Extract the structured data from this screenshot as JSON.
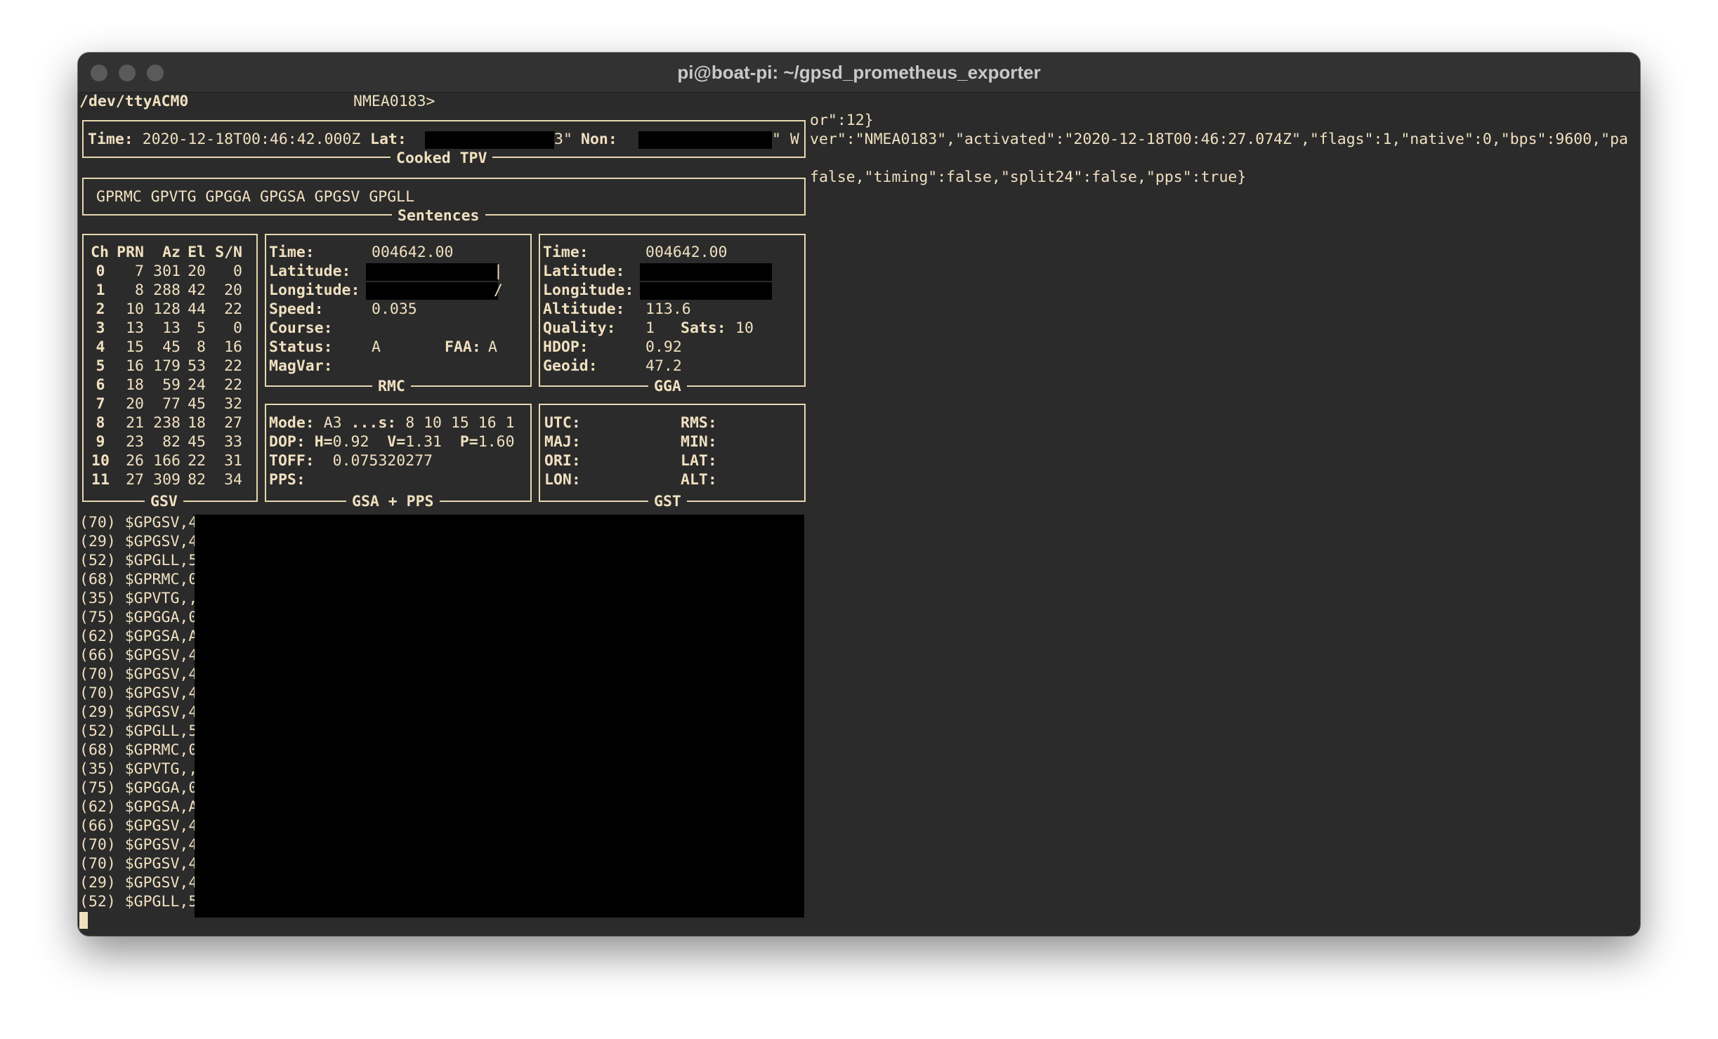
{
  "window": {
    "title": "pi@boat-pi: ~/gpsd_prometheus_exporter"
  },
  "header": {
    "device": "/dev/ttyACM0",
    "mode": "NMEA0183>"
  },
  "tpv": {
    "caption": "Cooked TPV",
    "time_label": "Time:",
    "time": "2020-12-18T00:46:42.000Z",
    "lat_label": "Lat:",
    "lat_tail": "3\"",
    "lon_label": "Non:",
    "lon_tail": "\" W"
  },
  "sentences": {
    "caption": "Sentences",
    "list": "GPRMC GPVTG GPGGA GPGSA GPGSV GPGLL"
  },
  "json_lines": [
    "or\":12}",
    "ver\":\"NMEA0183\",\"activated\":\"2020-12-18T00:46:27.074Z\",\"flags\":1,\"native\":0,\"bps\":9600,\"pa",
    "false,\"timing\":false,\"split24\":false,\"pps\":true}"
  ],
  "gsv": {
    "caption": "GSV",
    "headers": [
      "Ch",
      "PRN",
      "Az",
      "El",
      "S/N"
    ],
    "rows": [
      [
        "0",
        "7",
        "301",
        "20",
        "0"
      ],
      [
        "1",
        "8",
        "288",
        "42",
        "20"
      ],
      [
        "2",
        "10",
        "128",
        "44",
        "22"
      ],
      [
        "3",
        "13",
        "13",
        "5",
        "0"
      ],
      [
        "4",
        "15",
        "45",
        "8",
        "16"
      ],
      [
        "5",
        "16",
        "179",
        "53",
        "22"
      ],
      [
        "6",
        "18",
        "59",
        "24",
        "22"
      ],
      [
        "7",
        "20",
        "77",
        "45",
        "32"
      ],
      [
        "8",
        "21",
        "238",
        "18",
        "27"
      ],
      [
        "9",
        "23",
        "82",
        "45",
        "33"
      ],
      [
        "10",
        "26",
        "166",
        "22",
        "31"
      ],
      [
        "11",
        "27",
        "309",
        "82",
        "34"
      ]
    ]
  },
  "rmc": {
    "caption": "RMC",
    "time_label": "Time:",
    "time": "004642.00",
    "lat_label": "Latitude:",
    "lat_tail": "|",
    "lon_label": "Longitude:",
    "lon_tail": "/",
    "speed_label": "Speed:",
    "speed": "0.035",
    "course_label": "Course:",
    "status_label": "Status:",
    "status": "A",
    "faa_label": "FAA:",
    "faa": "A",
    "magvar_label": "MagVar:"
  },
  "gga": {
    "caption": "GGA",
    "time_label": "Time:",
    "time": "004642.00",
    "lat_label": "Latitude:",
    "lon_label": "Longitude:",
    "alt_label": "Altitude:",
    "alt": "113.6",
    "quality_label": "Quality:",
    "quality": "1",
    "sats_label": "Sats:",
    "sats": "10",
    "hdop_label": "HDOP:",
    "hdop": "0.92",
    "geoid_label": "Geoid:",
    "geoid": "47.2"
  },
  "gsa": {
    "caption": "GSA + PPS",
    "mode_label": "Mode:",
    "mode": "A3",
    "sats_label": "...s:",
    "sats": "8 10 15 16 1",
    "dop_label": "DOP:",
    "h_label": "H=",
    "h": "0.92",
    "v_label": "V=",
    "v": "1.31",
    "p_label": "P=",
    "p": "1.60",
    "toff_label": "TOFF:",
    "toff": "0.075320277",
    "pps_label": "PPS:"
  },
  "gst": {
    "caption": "GST",
    "utc_label": "UTC:",
    "rms_label": "RMS:",
    "maj_label": "MAJ:",
    "min_label": "MIN:",
    "ori_label": "ORI:",
    "lat_label": "LAT:",
    "lon_label": "LON:",
    "alt_label": "ALT:"
  },
  "log": [
    "(70) $GPGSV,4",
    "(29) $GPGSV,4",
    "(52) $GPGLL,5",
    "(68) $GPRMC,0",
    "(35) $GPVTG,,",
    "(75) $GPGGA,0",
    "(62) $GPGSA,A",
    "(66) $GPGSV,4",
    "(70) $GPGSV,4",
    "(70) $GPGSV,4",
    "(29) $GPGSV,4",
    "(52) $GPGLL,5",
    "(68) $GPRMC,0",
    "(35) $GPVTG,,",
    "(75) $GPGGA,0",
    "(62) $GPGSA,A",
    "(66) $GPGSV,4",
    "(70) $GPGSV,4",
    "(70) $GPGSV,4",
    "(29) $GPGSV,4",
    "(52) $GPGLL,5"
  ]
}
